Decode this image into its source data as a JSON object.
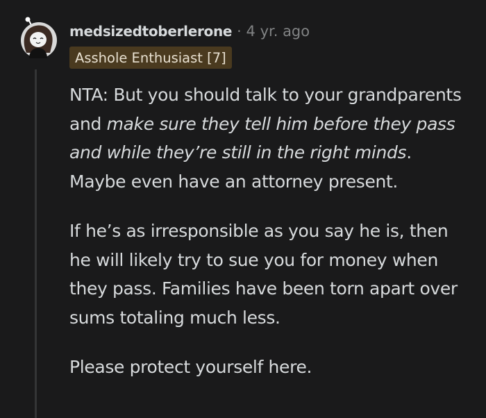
{
  "comment": {
    "author": "medsizedtoberlerone",
    "separator": "·",
    "timestamp": "4 yr. ago",
    "flair": "Asshole Enthusiast [7]",
    "avatar_icon": "snoo-avatar-icon",
    "paragraphs": [
      {
        "segments": [
          {
            "text": "NTA: But you should talk to your grandparents and ",
            "italic": false
          },
          {
            "text": "make sure they tell him before they pass and while they’re still in the right minds",
            "italic": true
          },
          {
            "text": ". Maybe even have an attorney present.",
            "italic": false
          }
        ]
      },
      {
        "segments": [
          {
            "text": "If he’s as irresponsible as you say he is, then he will likely try to sue you for money when they pass. Families have been torn apart over sums totaling much less.",
            "italic": false
          }
        ]
      },
      {
        "segments": [
          {
            "text": "Please protect yourself here.",
            "italic": false
          }
        ]
      }
    ]
  },
  "colors": {
    "background": "#1a1a1b",
    "text": "#d7dadc",
    "meta": "#818384",
    "flair_bg": "#4a3a1f",
    "thread_line": "#343536"
  }
}
